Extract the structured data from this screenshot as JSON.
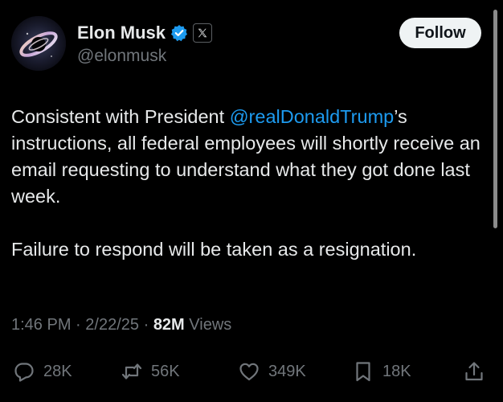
{
  "author": {
    "display_name": "Elon Musk",
    "handle": "@elonmusk",
    "verified": true,
    "affiliation": "X"
  },
  "follow_label": "Follow",
  "tweet": {
    "line1_pre": "Consistent with President ",
    "mention": "@realDonaldTrump",
    "line1_post": "’s instructions, all federal employees will shortly receive an email requesting to understand what they got done last week.",
    "paragraph2": "Failure to respond will be taken as a resignation."
  },
  "meta": {
    "time": "1:46 PM",
    "date": "2/22/25",
    "separator": "·",
    "views_count": "82M",
    "views_label": "Views"
  },
  "actions": {
    "replies": "28K",
    "reposts": "56K",
    "likes": "349K",
    "bookmarks": "18K"
  },
  "colors": {
    "background": "#000000",
    "text": "#e7e9ea",
    "secondary_text": "#71767b",
    "link": "#1d9bf0",
    "verified_badge": "#1d9bf0",
    "follow_button_bg": "#eff3f4"
  },
  "icons": [
    "verified-badge-icon",
    "x-logo-icon",
    "reply-icon",
    "repost-icon",
    "like-icon",
    "bookmark-icon",
    "share-icon"
  ]
}
